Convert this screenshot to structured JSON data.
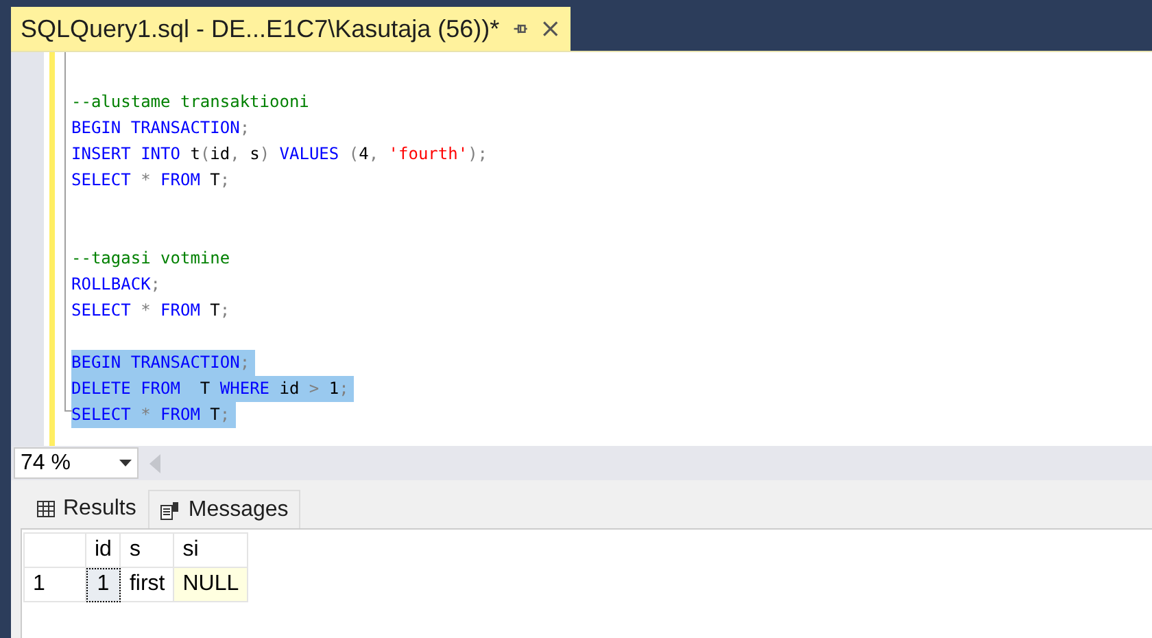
{
  "document_tab": {
    "title": "SQLQuery1.sql - DE...E1C7\\Kasutaja (56))*",
    "selected": true
  },
  "editor": {
    "lines": [
      {
        "kind": "blank",
        "selected": false
      },
      {
        "kind": "code",
        "selected": false,
        "tokens": [
          {
            "kind": "comment",
            "text": "--alustame transaktiooni"
          }
        ]
      },
      {
        "kind": "code",
        "selected": false,
        "tokens": [
          {
            "kind": "keyword",
            "text": "BEGIN TRANSACTION"
          },
          {
            "kind": "operator",
            "text": ";"
          }
        ]
      },
      {
        "kind": "code",
        "selected": false,
        "tokens": [
          {
            "kind": "keyword",
            "text": "INSERT INTO"
          },
          {
            "kind": "plain",
            "text": " t"
          },
          {
            "kind": "operator",
            "text": "("
          },
          {
            "kind": "plain",
            "text": "id"
          },
          {
            "kind": "operator",
            "text": ","
          },
          {
            "kind": "plain",
            "text": " s"
          },
          {
            "kind": "operator",
            "text": ") "
          },
          {
            "kind": "keyword",
            "text": "VALUES"
          },
          {
            "kind": "operator",
            "text": " ("
          },
          {
            "kind": "plain",
            "text": "4"
          },
          {
            "kind": "operator",
            "text": ", "
          },
          {
            "kind": "string",
            "text": "'fourth'"
          },
          {
            "kind": "operator",
            "text": ");"
          }
        ]
      },
      {
        "kind": "code",
        "selected": false,
        "tokens": [
          {
            "kind": "keyword",
            "text": "SELECT"
          },
          {
            "kind": "operator",
            "text": " * "
          },
          {
            "kind": "keyword",
            "text": "FROM"
          },
          {
            "kind": "plain",
            "text": " T"
          },
          {
            "kind": "operator",
            "text": ";"
          }
        ]
      },
      {
        "kind": "blank",
        "selected": false
      },
      {
        "kind": "blank",
        "selected": false
      },
      {
        "kind": "code",
        "selected": false,
        "tokens": [
          {
            "kind": "comment",
            "text": "--tagasi votmine"
          }
        ]
      },
      {
        "kind": "code",
        "selected": false,
        "tokens": [
          {
            "kind": "keyword",
            "text": "ROLLBACK"
          },
          {
            "kind": "operator",
            "text": ";"
          }
        ]
      },
      {
        "kind": "code",
        "selected": false,
        "tokens": [
          {
            "kind": "keyword",
            "text": "SELECT"
          },
          {
            "kind": "operator",
            "text": " * "
          },
          {
            "kind": "keyword",
            "text": "FROM"
          },
          {
            "kind": "plain",
            "text": " T"
          },
          {
            "kind": "operator",
            "text": ";"
          }
        ]
      },
      {
        "kind": "blank",
        "selected": false
      },
      {
        "kind": "code",
        "selected": true,
        "tokens": [
          {
            "kind": "keyword",
            "text": "BEGIN TRANSACTION"
          },
          {
            "kind": "operator",
            "text": ";"
          }
        ]
      },
      {
        "kind": "code",
        "selected": true,
        "tokens": [
          {
            "kind": "keyword",
            "text": "DELETE FROM"
          },
          {
            "kind": "plain",
            "text": "  T "
          },
          {
            "kind": "keyword",
            "text": "WHERE"
          },
          {
            "kind": "plain",
            "text": " id "
          },
          {
            "kind": "operator",
            "text": ">"
          },
          {
            "kind": "plain",
            "text": " 1"
          },
          {
            "kind": "operator",
            "text": ";"
          }
        ]
      },
      {
        "kind": "code",
        "selected": true,
        "tokens": [
          {
            "kind": "keyword",
            "text": "SELECT"
          },
          {
            "kind": "operator",
            "text": " * "
          },
          {
            "kind": "keyword",
            "text": "FROM"
          },
          {
            "kind": "plain",
            "text": " T"
          },
          {
            "kind": "operator",
            "text": ";"
          }
        ]
      }
    ]
  },
  "zoom": {
    "value": "74 %"
  },
  "result_tabs": [
    {
      "label": "Results",
      "selected": true
    },
    {
      "label": "Messages",
      "selected": false
    }
  ],
  "grid": {
    "columns": [
      "id",
      "s",
      "si"
    ],
    "rows": [
      {
        "row_number": "1",
        "cells": [
          {
            "kind": "value",
            "text": "1",
            "selected": true
          },
          {
            "kind": "value",
            "text": "first",
            "selected": false
          },
          {
            "kind": "null",
            "text": "NULL",
            "selected": false
          }
        ]
      }
    ]
  }
}
